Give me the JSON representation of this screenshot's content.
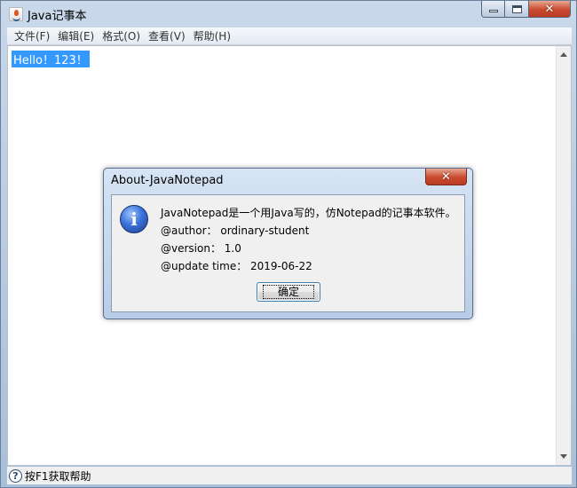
{
  "window": {
    "title": "Java记事本",
    "controls": {
      "minimize": "—",
      "maximize": "□",
      "close": "✕"
    }
  },
  "menu": {
    "items": [
      "文件(F)",
      "编辑(E)",
      "格式(O)",
      "查看(V)",
      "帮助(H)"
    ]
  },
  "editor": {
    "text": "Hello！123！",
    "selected": true
  },
  "statusbar": {
    "help_icon": "?",
    "text": "按F1获取帮助"
  },
  "dialog": {
    "title": "About-JavaNotepad",
    "icon": "i",
    "lines": [
      "JavaNotepad是一个用Java写的，仿Notepad的记事本软件。",
      "@author： ordinary-student",
      "@version： 1.0",
      "@update time： 2019-06-22"
    ],
    "ok_label": "确定"
  },
  "colors": {
    "selection": "#3399ff",
    "close_button": "#c94a2f"
  }
}
